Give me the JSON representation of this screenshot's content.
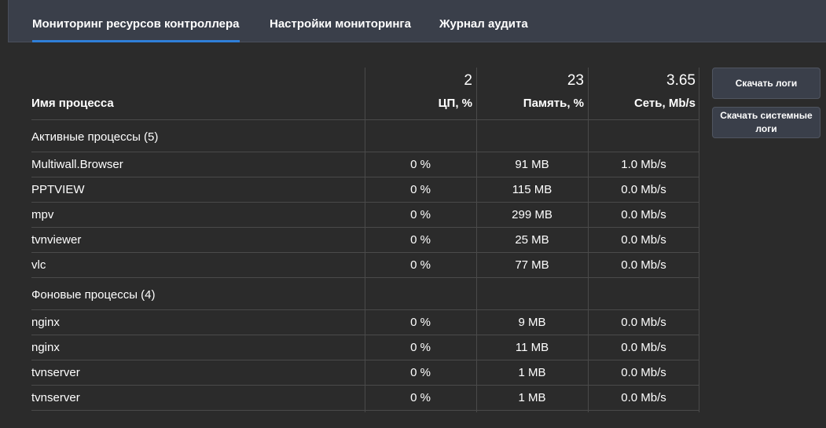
{
  "tabs": [
    {
      "label": "Мониторинг ресурсов контроллера",
      "active": true
    },
    {
      "label": "Настройки мониторинга",
      "active": false
    },
    {
      "label": "Журнал аудита",
      "active": false
    }
  ],
  "table": {
    "columns": {
      "name": "Имя процесса",
      "cpu": {
        "total": "2",
        "label": "ЦП, %"
      },
      "mem": {
        "total": "23",
        "label": "Память, %"
      },
      "net": {
        "total": "3.65",
        "label": "Сеть, Mb/s"
      }
    },
    "groups": [
      {
        "title": "Активные процессы (5)",
        "rows": [
          {
            "name": "Multiwall.Browser",
            "cpu": "0 %",
            "mem": "91 MB",
            "net": "1.0 Mb/s"
          },
          {
            "name": "PPTVIEW",
            "cpu": "0 %",
            "mem": "115 MB",
            "net": "0.0 Mb/s"
          },
          {
            "name": "mpv",
            "cpu": "0 %",
            "mem": "299 MB",
            "net": "0.0 Mb/s"
          },
          {
            "name": "tvnviewer",
            "cpu": "0 %",
            "mem": "25 MB",
            "net": "0.0 Mb/s"
          },
          {
            "name": "vlc",
            "cpu": "0 %",
            "mem": "77 MB",
            "net": "0.0 Mb/s"
          }
        ]
      },
      {
        "title": "Фоновые процессы (4)",
        "rows": [
          {
            "name": "nginx",
            "cpu": "0 %",
            "mem": "9 MB",
            "net": "0.0 Mb/s"
          },
          {
            "name": "nginx",
            "cpu": "0 %",
            "mem": "11 MB",
            "net": "0.0 Mb/s"
          },
          {
            "name": "tvnserver",
            "cpu": "0 %",
            "mem": "1 MB",
            "net": "0.0 Mb/s"
          },
          {
            "name": "tvnserver",
            "cpu": "0 %",
            "mem": "1 MB",
            "net": "0.0 Mb/s"
          }
        ]
      }
    ]
  },
  "buttons": {
    "download_logs": "Скачать логи",
    "download_system_logs": "Скачать системные логи"
  },
  "colors": {
    "accent": "#2f7fd8",
    "tabbar_bg": "#3a3f4a",
    "page_bg": "#2b2b2b"
  }
}
